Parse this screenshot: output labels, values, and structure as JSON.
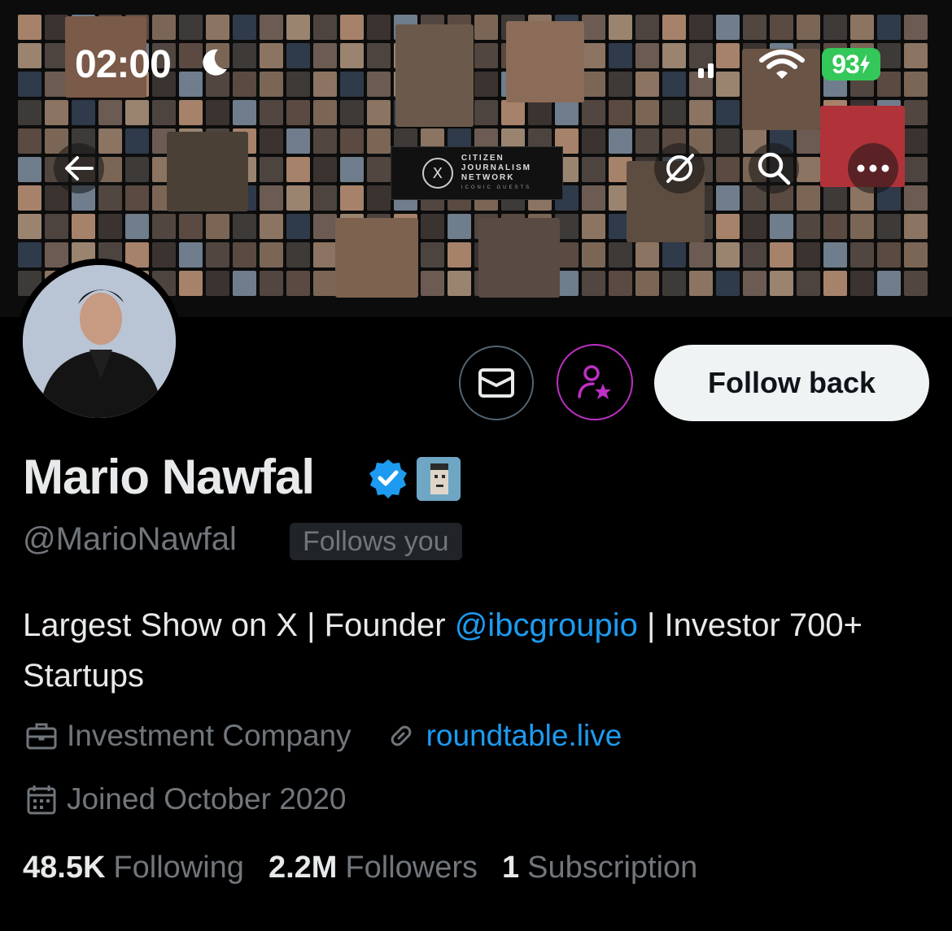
{
  "status_bar": {
    "time": "02:00",
    "battery": "93"
  },
  "banner": {
    "logo_line1": "CITIZEN",
    "logo_line2": "JOURNALISM",
    "logo_line3": "NETWORK",
    "logo_sub": "ICONIC GUESTS"
  },
  "nav": {
    "back_icon": "arrow-left-icon",
    "grok_icon": "grok-icon",
    "search_icon": "search-icon",
    "more_icon": "more-horizontal-icon"
  },
  "actions": {
    "follow_back_label": "Follow back",
    "message_icon": "envelope-icon",
    "subscribe_icon": "person-star-icon"
  },
  "profile": {
    "name": "Mario Nawfal",
    "handle": "@MarioNawfal",
    "follows_you": "Follows you",
    "bio_part1": "Largest Show on X | Founder ",
    "bio_mention": "@ibcgroupio",
    "bio_part2": " | Investor 700+ Startups",
    "category": "Investment Company",
    "website": "roundtable.live",
    "joined": "Joined October 2020"
  },
  "stats": {
    "following_count": "48.5K",
    "following_label": "Following",
    "followers_count": "2.2M",
    "followers_label": "Followers",
    "subscriptions_count": "1",
    "subscriptions_label": "Subscription"
  },
  "colors": {
    "accent": "#1d9bf0",
    "subscribe_ring": "#c02fc6",
    "muted": "#71767b",
    "battery": "#34c759"
  }
}
